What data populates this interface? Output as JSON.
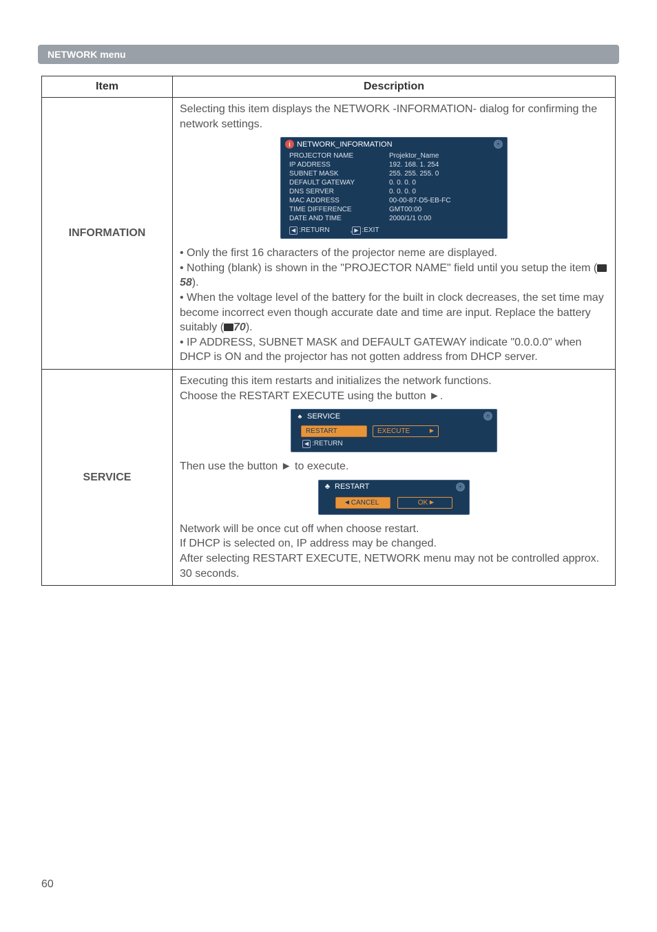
{
  "header": {
    "title": "NETWORK menu"
  },
  "table": {
    "headers": {
      "item": "Item",
      "description": "Description"
    },
    "rows": [
      {
        "item": "INFORMATION",
        "desc_top": "Selecting this item displays the NETWORK -INFORMATION- dialog for confirming the network settings.",
        "osd": {
          "title": "NETWORK_INFORMATION",
          "rows": [
            {
              "k": "PROJECTOR NAME",
              "v": "Projektor_Name"
            },
            {
              "k": "IP ADDRESS",
              "v": "192. 168.  1. 254"
            },
            {
              "k": "SUBNET MASK",
              "v": "255. 255. 255.  0"
            },
            {
              "k": "DEFAULT GATEWAY",
              "v": "0.  0.  0.  0"
            },
            {
              "k": "DNS SERVER",
              "v": "0.  0.  0.  0"
            },
            {
              "k": "MAC ADDRESS",
              "v": "00-00-87-D5-EB-FC"
            },
            {
              "k": "TIME DIFFERENCE",
              "v": "GMT00:00"
            },
            {
              "k": "DATE AND TIME",
              "v": "2000/1/1   0:00"
            }
          ],
          "footer": {
            "return": ":RETURN",
            "exit": ":EXIT"
          }
        },
        "bullets": {
          "b1": "• Only the first 16 characters of the projector neme are displayed.",
          "b2a": "• Nothing (blank) is shown in the \"PROJECTOR NAME\" field until you setup the item (",
          "b2ref": "58",
          "b2b": ").",
          "b3a": "• When the voltage level of the battery for the built in clock decreases, the set time may become incorrect even though accurate date and time are input. Replace the battery suitably (",
          "b3ref": "70",
          "b3b": ").",
          "b4": "• IP ADDRESS, SUBNET MASK and DEFAULT GATEWAY indicate \"0.0.0.0\" when DHCP is ON and the projector has not gotten address from DHCP server."
        }
      },
      {
        "item": "SERVICE",
        "desc_top": "Executing this item restarts and initializes the network functions.\nChoose the RESTART EXECUTE using the button ►.",
        "osd_service": {
          "title": "SERVICE",
          "restart_label": "RESTART",
          "execute_label": "EXECUTE",
          "return_label": ":RETURN"
        },
        "mid_text": "Then use the button ► to execute.",
        "osd_restart": {
          "title": "RESTART",
          "cancel": "CANCEL",
          "ok": "OK"
        },
        "bottom_text": "Network will be once cut off when choose restart.\nIf DHCP is selected on, IP address may be changed.\nAfter selecting RESTART EXECUTE, NETWORK menu may not be controlled approx. 30 seconds."
      }
    ]
  },
  "page_number": "60"
}
